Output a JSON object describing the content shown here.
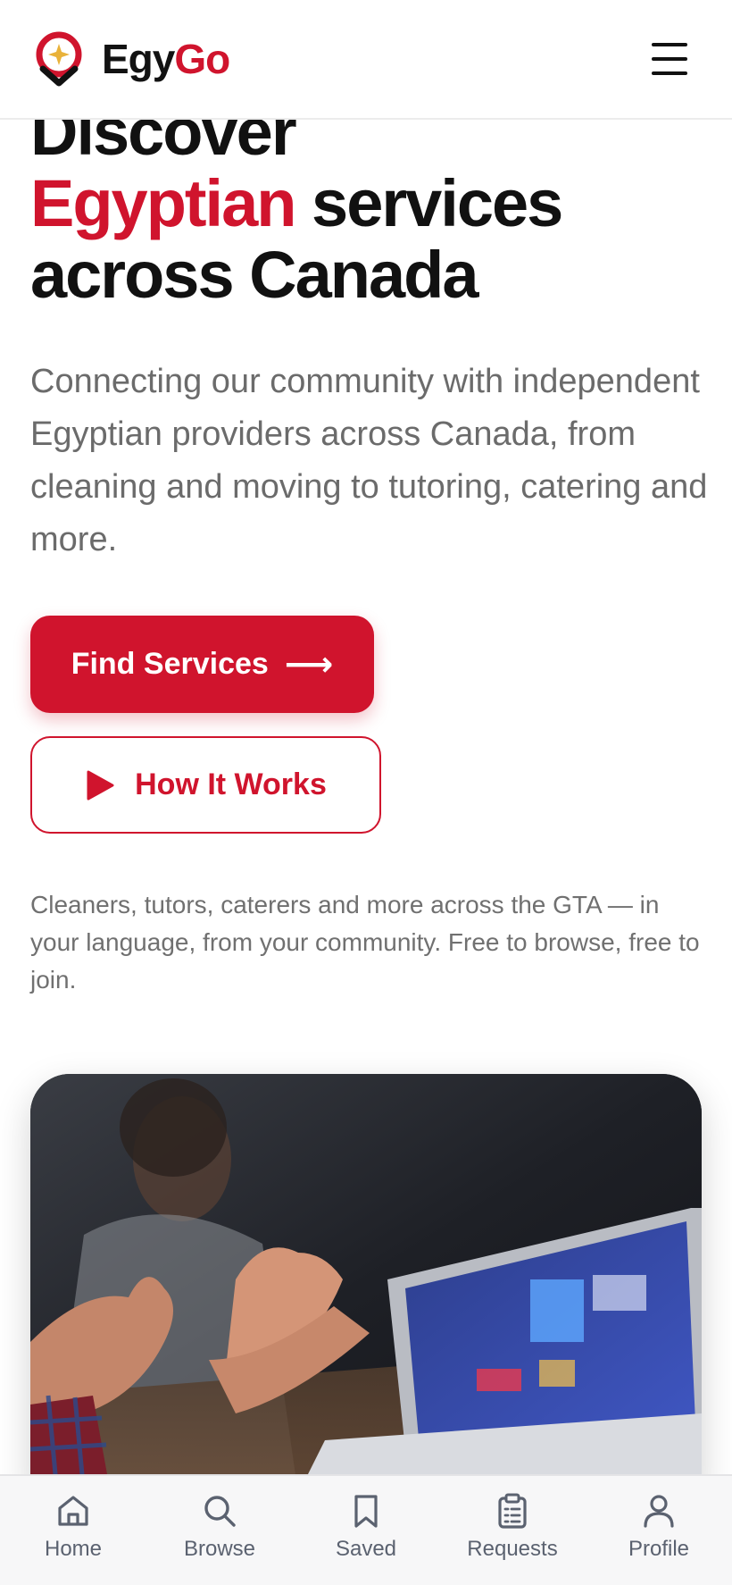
{
  "brand": {
    "name_part1": "Egy",
    "name_part2": "Go"
  },
  "hero": {
    "title_line1": "Discover",
    "title_accent": "Egyptian",
    "title_rest": " services",
    "title_line3": "across Canada",
    "lead": "Connecting our community with independent Egyptian providers across Canada, from cleaning and moving to tutoring, catering and more."
  },
  "actions": {
    "find_services_label": "Find Services",
    "find_services_arrow": "⟶",
    "how_it_works_label": "How It Works"
  },
  "subtext": "Cleaners, tutors, caterers and more across the GTA — in your language, from your community. Free to browse, free to join.",
  "nav": {
    "items": [
      {
        "label": "Home",
        "icon": "home-icon"
      },
      {
        "label": "Browse",
        "icon": "search-icon"
      },
      {
        "label": "Saved",
        "icon": "bookmark-icon"
      },
      {
        "label": "Requests",
        "icon": "clipboard-icon"
      },
      {
        "label": "Profile",
        "icon": "user-icon"
      }
    ]
  },
  "colors": {
    "accent": "#d0142d",
    "logo_star": "#e9b23a",
    "text": "#111111",
    "muted": "#6b6b6b"
  }
}
